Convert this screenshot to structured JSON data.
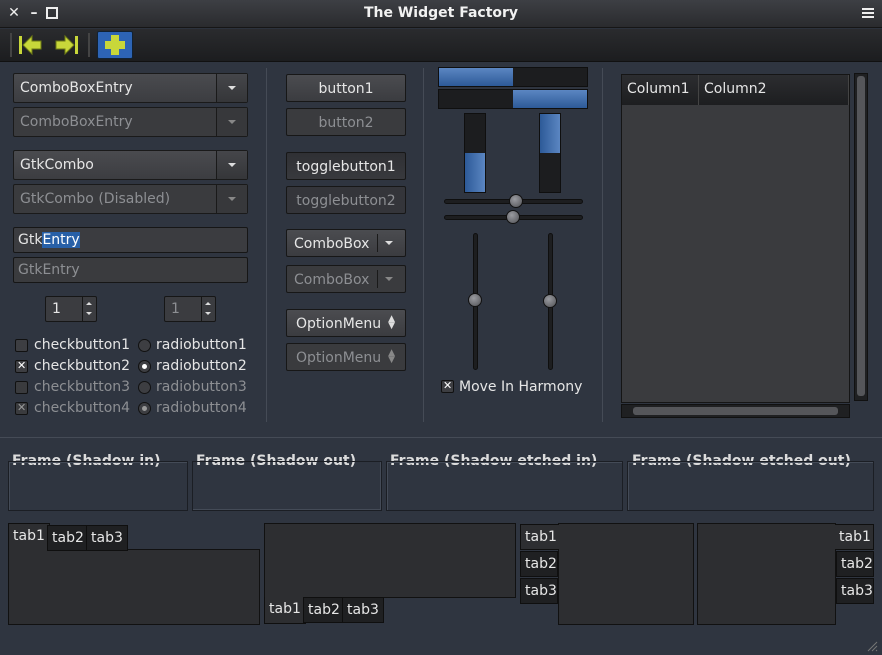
{
  "window": {
    "title": "The Widget Factory"
  },
  "colors": {
    "accent": "#2860a7",
    "background": "#2f3540"
  },
  "toolbar": {
    "back_icon": "go-first-icon",
    "forward_icon": "go-last-icon",
    "add_icon": "add-icon"
  },
  "left": {
    "combo_entry": "ComboBoxEntry",
    "combo_entry_disabled": "ComboBoxEntry",
    "gtk_combo": "GtkCombo",
    "gtk_combo_disabled": "GtkCombo (Disabled)",
    "entry_prefix": "Gtk",
    "entry_selected": "Entry",
    "entry_disabled": "GtkEntry",
    "spin1": "1",
    "spin2": "1",
    "checks": [
      "checkbutton1",
      "checkbutton2",
      "checkbutton3",
      "checkbutton4"
    ],
    "radios": [
      "radiobutton1",
      "radiobutton2",
      "radiobutton3",
      "radiobutton4"
    ]
  },
  "middle": {
    "button1": "button1",
    "button2": "button2",
    "toggle1": "togglebutton1",
    "toggle2": "togglebutton2",
    "combobox1": "ComboBox",
    "combobox2": "ComboBox",
    "option1": "OptionMenu",
    "option2": "OptionMenu"
  },
  "sliders": {
    "progress_h1": 0.5,
    "progress_h2": 0.5,
    "progress_v1": 0.5,
    "progress_v2": 0.5,
    "move_in_harmony": "Move In Harmony"
  },
  "tree": {
    "columns": [
      "Column1",
      "Column2"
    ]
  },
  "frames": [
    "Frame (Shadow in)",
    "Frame (Shadow out)",
    "Frame (Shadow etched in)",
    "Frame (Shadow etched out)"
  ],
  "notebooks": {
    "top": [
      "tab1",
      "tab2",
      "tab3"
    ],
    "bottom": [
      "tab1",
      "tab2",
      "tab3"
    ],
    "left": [
      "tab1",
      "tab2",
      "tab3"
    ],
    "right": [
      "tab1",
      "tab2",
      "tab3"
    ]
  }
}
